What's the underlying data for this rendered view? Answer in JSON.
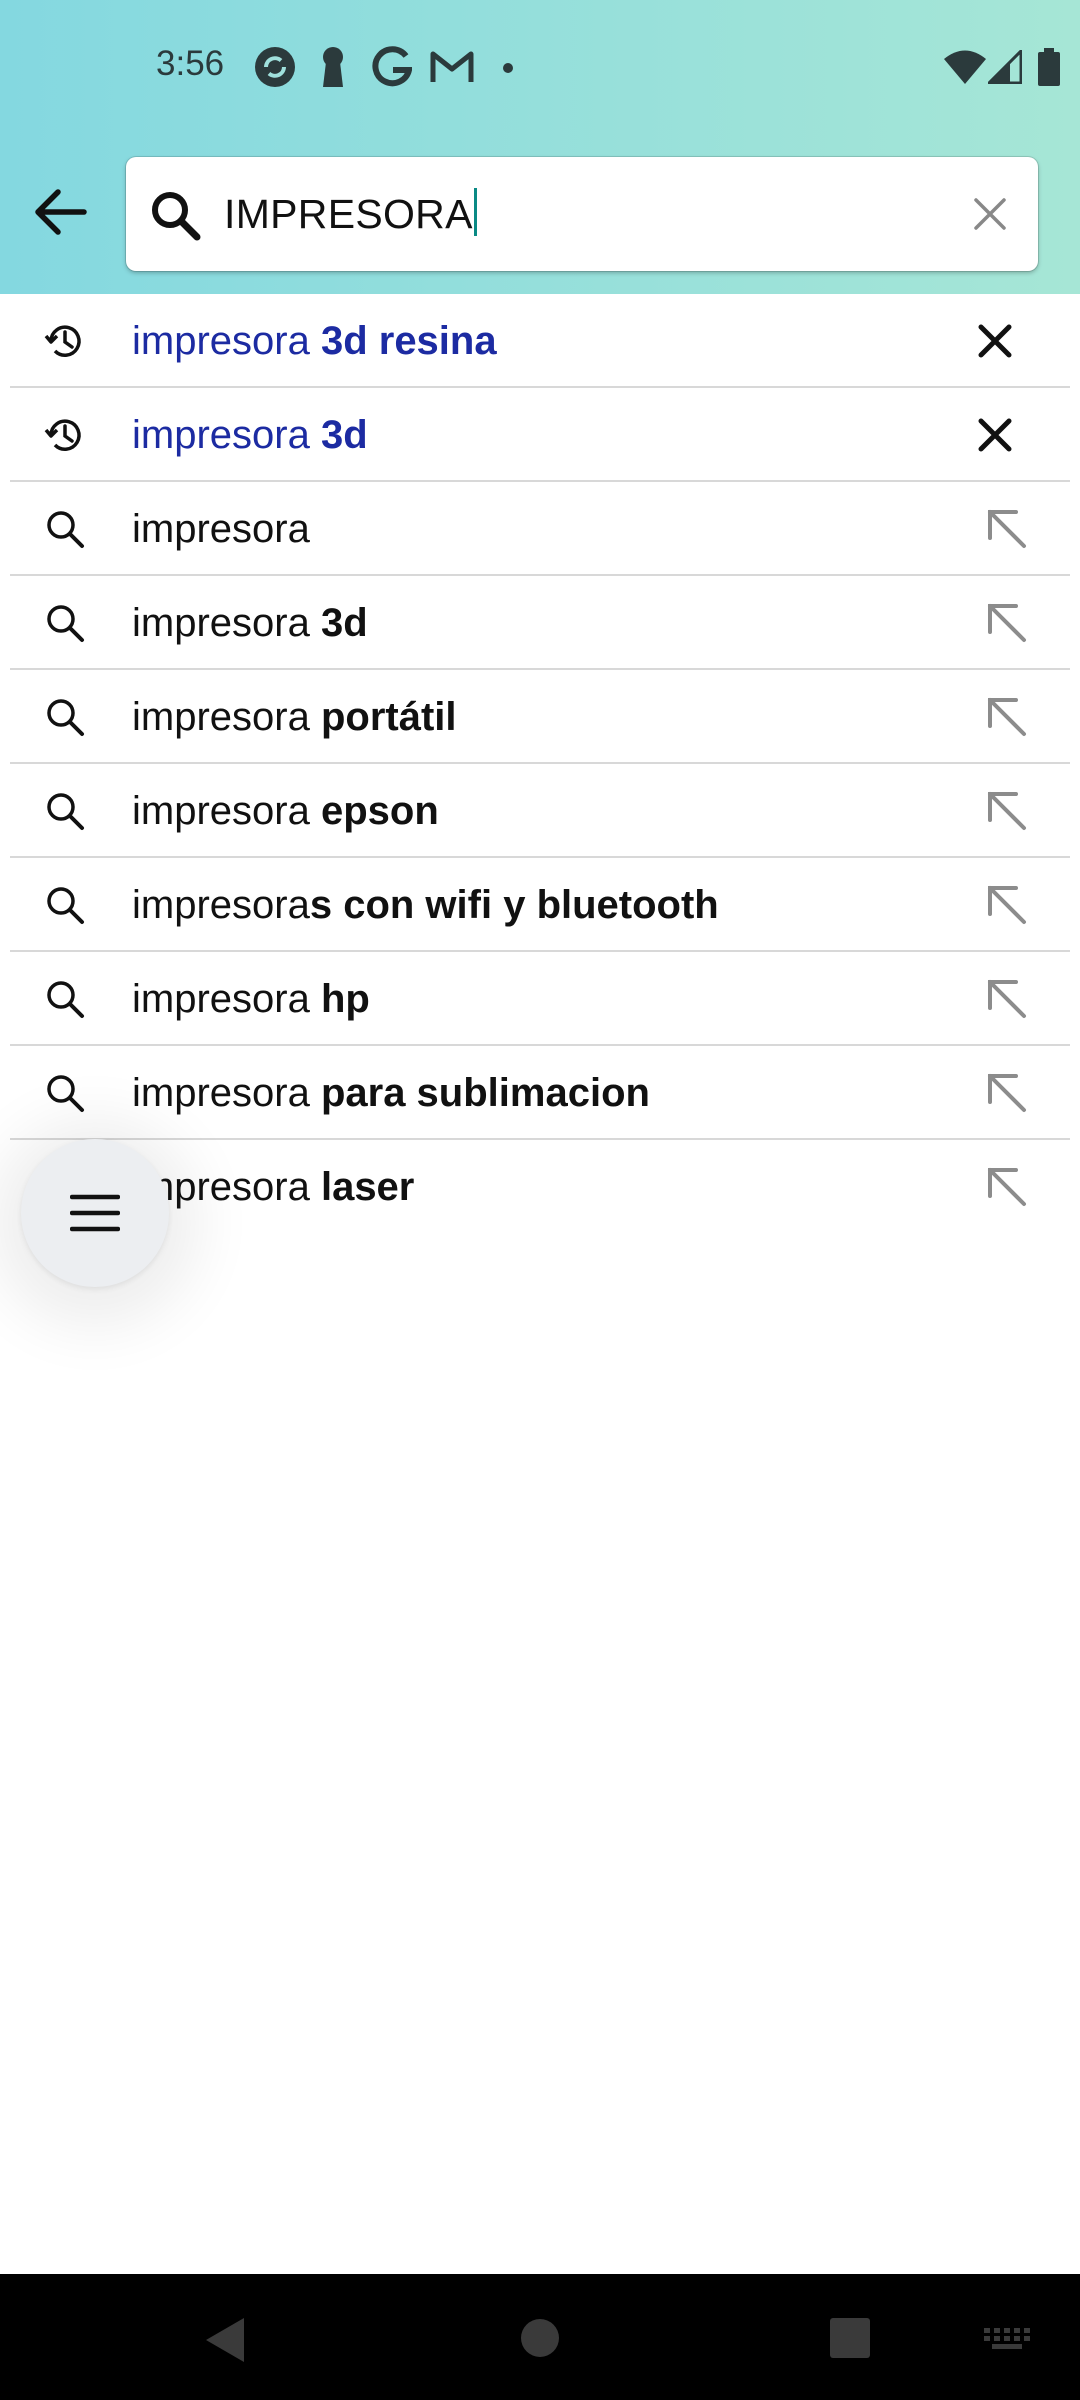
{
  "status_bar": {
    "time": "3:56",
    "left_icons": [
      "sync-app-icon",
      "keyhole-icon",
      "google-icon",
      "gmail-icon",
      "dot-icon"
    ],
    "right_icons": [
      "wifi-icon",
      "signal-icon",
      "battery-icon"
    ]
  },
  "search": {
    "value": "IMPRESORA",
    "back_icon": "arrow-left-icon",
    "search_icon": "search-icon",
    "clear_icon": "close-icon"
  },
  "suggestions": [
    {
      "type": "history",
      "prefix": "impresora ",
      "bold": "3d resina"
    },
    {
      "type": "history",
      "prefix": "impresora ",
      "bold": "3d"
    },
    {
      "type": "suggestion",
      "prefix": "impresora",
      "bold": ""
    },
    {
      "type": "suggestion",
      "prefix": "impresora ",
      "bold": "3d"
    },
    {
      "type": "suggestion",
      "prefix": "impresora ",
      "bold": "portátil"
    },
    {
      "type": "suggestion",
      "prefix": "impresora ",
      "bold": "epson"
    },
    {
      "type": "suggestion",
      "prefix": "impresora",
      "bold": "s con wifi y bluetooth"
    },
    {
      "type": "suggestion",
      "prefix": "impresora ",
      "bold": "hp"
    },
    {
      "type": "suggestion",
      "prefix": "impresora ",
      "bold": "para sublimacion"
    },
    {
      "type": "suggestion",
      "prefix": "impresora ",
      "bold": "laser"
    }
  ],
  "fab": {
    "icon": "hamburger-menu-icon"
  },
  "navbar": {
    "icons": [
      "nav-back-icon",
      "nav-home-icon",
      "nav-recents-icon",
      "keyboard-icon"
    ]
  },
  "colors": {
    "header_gradient_start": "#84d8e0",
    "header_gradient_end": "#a6e6d6",
    "history_text": "#1c2ba2",
    "caret": "#0a8a85"
  }
}
